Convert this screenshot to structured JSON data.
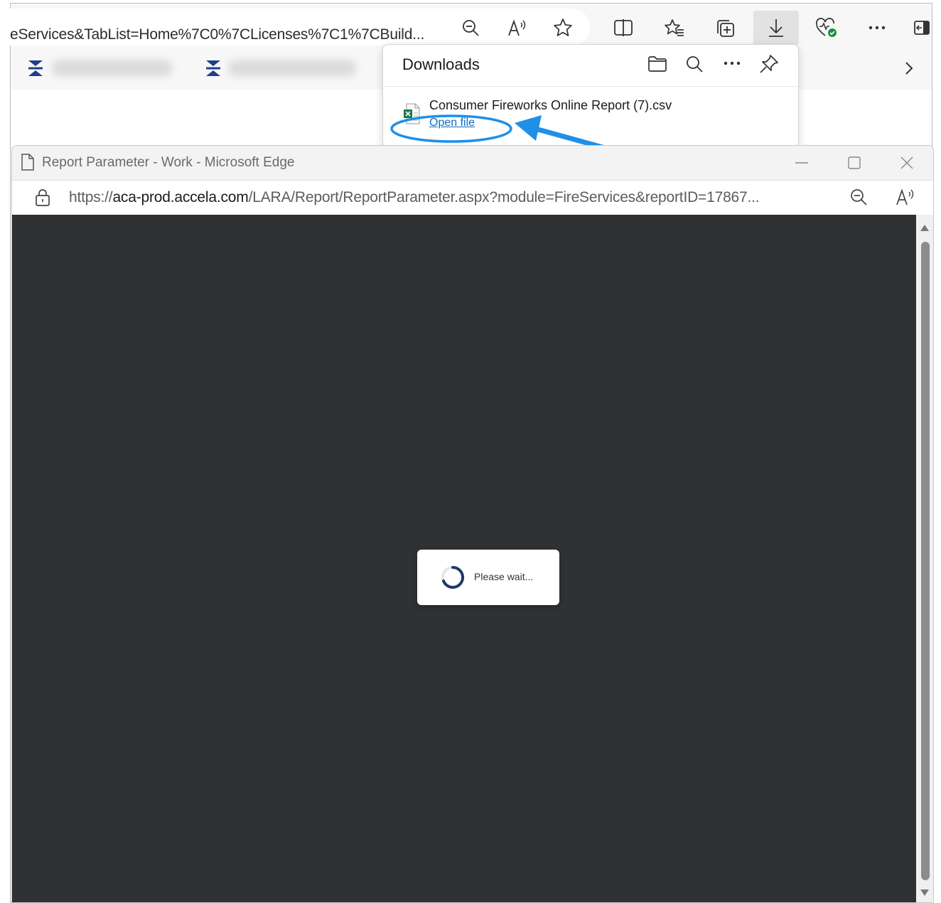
{
  "background_browser": {
    "url": "eServices&TabList=Home%7C0%7CLicenses%7C1%7CBuild...",
    "toolbar_icons": [
      "zoom-out-icon",
      "read-aloud-icon",
      "favorite-star-icon",
      "split-screen-icon",
      "favorites-icon",
      "collections-icon",
      "download-icon",
      "browser-essentials-icon",
      "more-options-icon",
      "sidebar-icon"
    ]
  },
  "downloads_panel": {
    "title": "Downloads",
    "item": {
      "filename": "Consumer Fireworks Online Report (7).csv",
      "action_label": "Open file",
      "file_icon": "excel-csv-file-icon"
    },
    "header_icons": [
      "open-folder-icon",
      "search-icon",
      "more-icon",
      "pin-icon"
    ]
  },
  "popup_window": {
    "title": "Report Parameter - Work - Microsoft Edge",
    "url_prefix": "https://",
    "url_host": "aca-prod.accela.com",
    "url_path": "/LARA/Report/ReportParameter.aspx?module=FireServices&reportID=17867...",
    "loading_message": "Please wait..."
  },
  "colors": {
    "content_bg": "#303133",
    "link_blue": "#0f6cbd",
    "annotation_blue": "#1e90e8"
  }
}
